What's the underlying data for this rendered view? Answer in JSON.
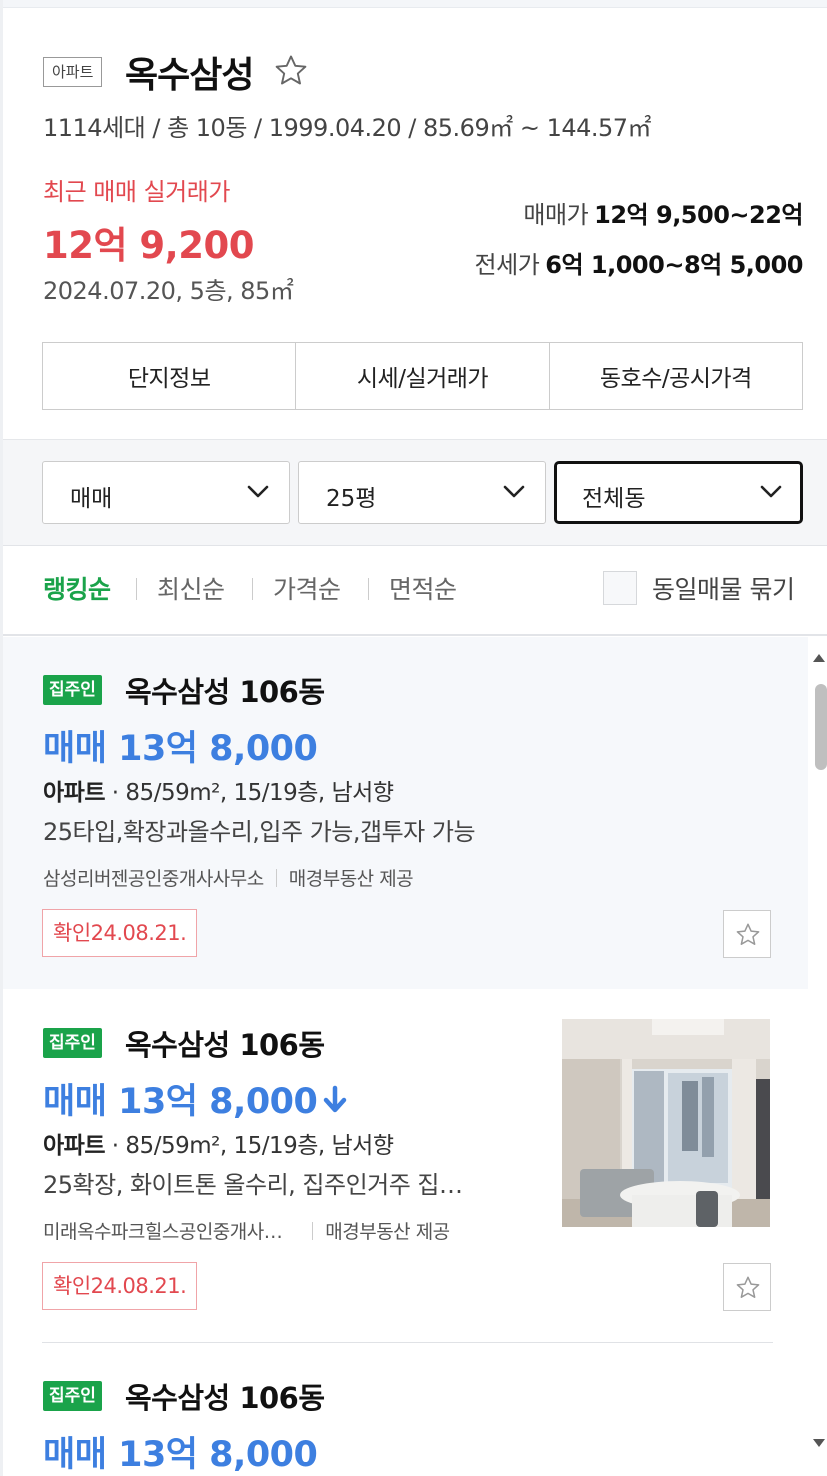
{
  "complex": {
    "type_badge": "아파트",
    "name": "옥수삼성",
    "meta": "1114세대 / 총 10동 / 1999.04.20 / 85.69㎡ ~ 144.57㎡",
    "recent_label": "최근 매매 실거래가",
    "recent_price": "12억 9,200",
    "recent_detail": "2024.07.20, 5층, 85㎡",
    "sale_range_label": "매매가",
    "sale_range_value": "12억 9,500~22억",
    "jeonse_range_label": "전세가",
    "jeonse_range_value": "6억 1,000~8억 5,000"
  },
  "tabs": [
    "단지정보",
    "시세/실거래가",
    "동호수/공시가격"
  ],
  "filters": {
    "trade_type": "매매",
    "size": "25평",
    "building": "전체동"
  },
  "sort": {
    "options": [
      "랭킹순",
      "최신순",
      "가격순",
      "면적순"
    ],
    "active": "랭킹순",
    "same_listing_label": "동일매물 묶기",
    "same_listing_checked": false
  },
  "listings": [
    {
      "badge": "집주인",
      "title": "옥수삼성 106동",
      "price": "매매 13억 8,000",
      "price_down": false,
      "kind": "아파트",
      "spec": "85/59m², 15/19층, 남서향",
      "desc": "25타입,확장과올수리,입주 가능,갭투자 가능",
      "agent": "삼성리버젠공인중개사사무소",
      "provider": "매경부동산 제공",
      "confirm": "확인24.08.21.",
      "favorited": false
    },
    {
      "badge": "집주인",
      "title": "옥수삼성 106동",
      "price": "매매 13억 8,000",
      "price_down": true,
      "kind": "아파트",
      "spec": "85/59m², 15/19층, 남서향",
      "desc": "25확장, 화이트톤 올수리, 집주인거주 집…",
      "agent": "미래옥수파크힐스공인중개사…",
      "provider": "매경부동산 제공",
      "confirm": "확인24.08.21.",
      "favorited": false
    },
    {
      "badge": "집주인",
      "title": "옥수삼성 106동",
      "price": "매매 13억 8,000"
    }
  ],
  "colors": {
    "accent_green": "#1aa34a",
    "price_blue": "#3d7fe0",
    "price_red": "#e2484f"
  }
}
